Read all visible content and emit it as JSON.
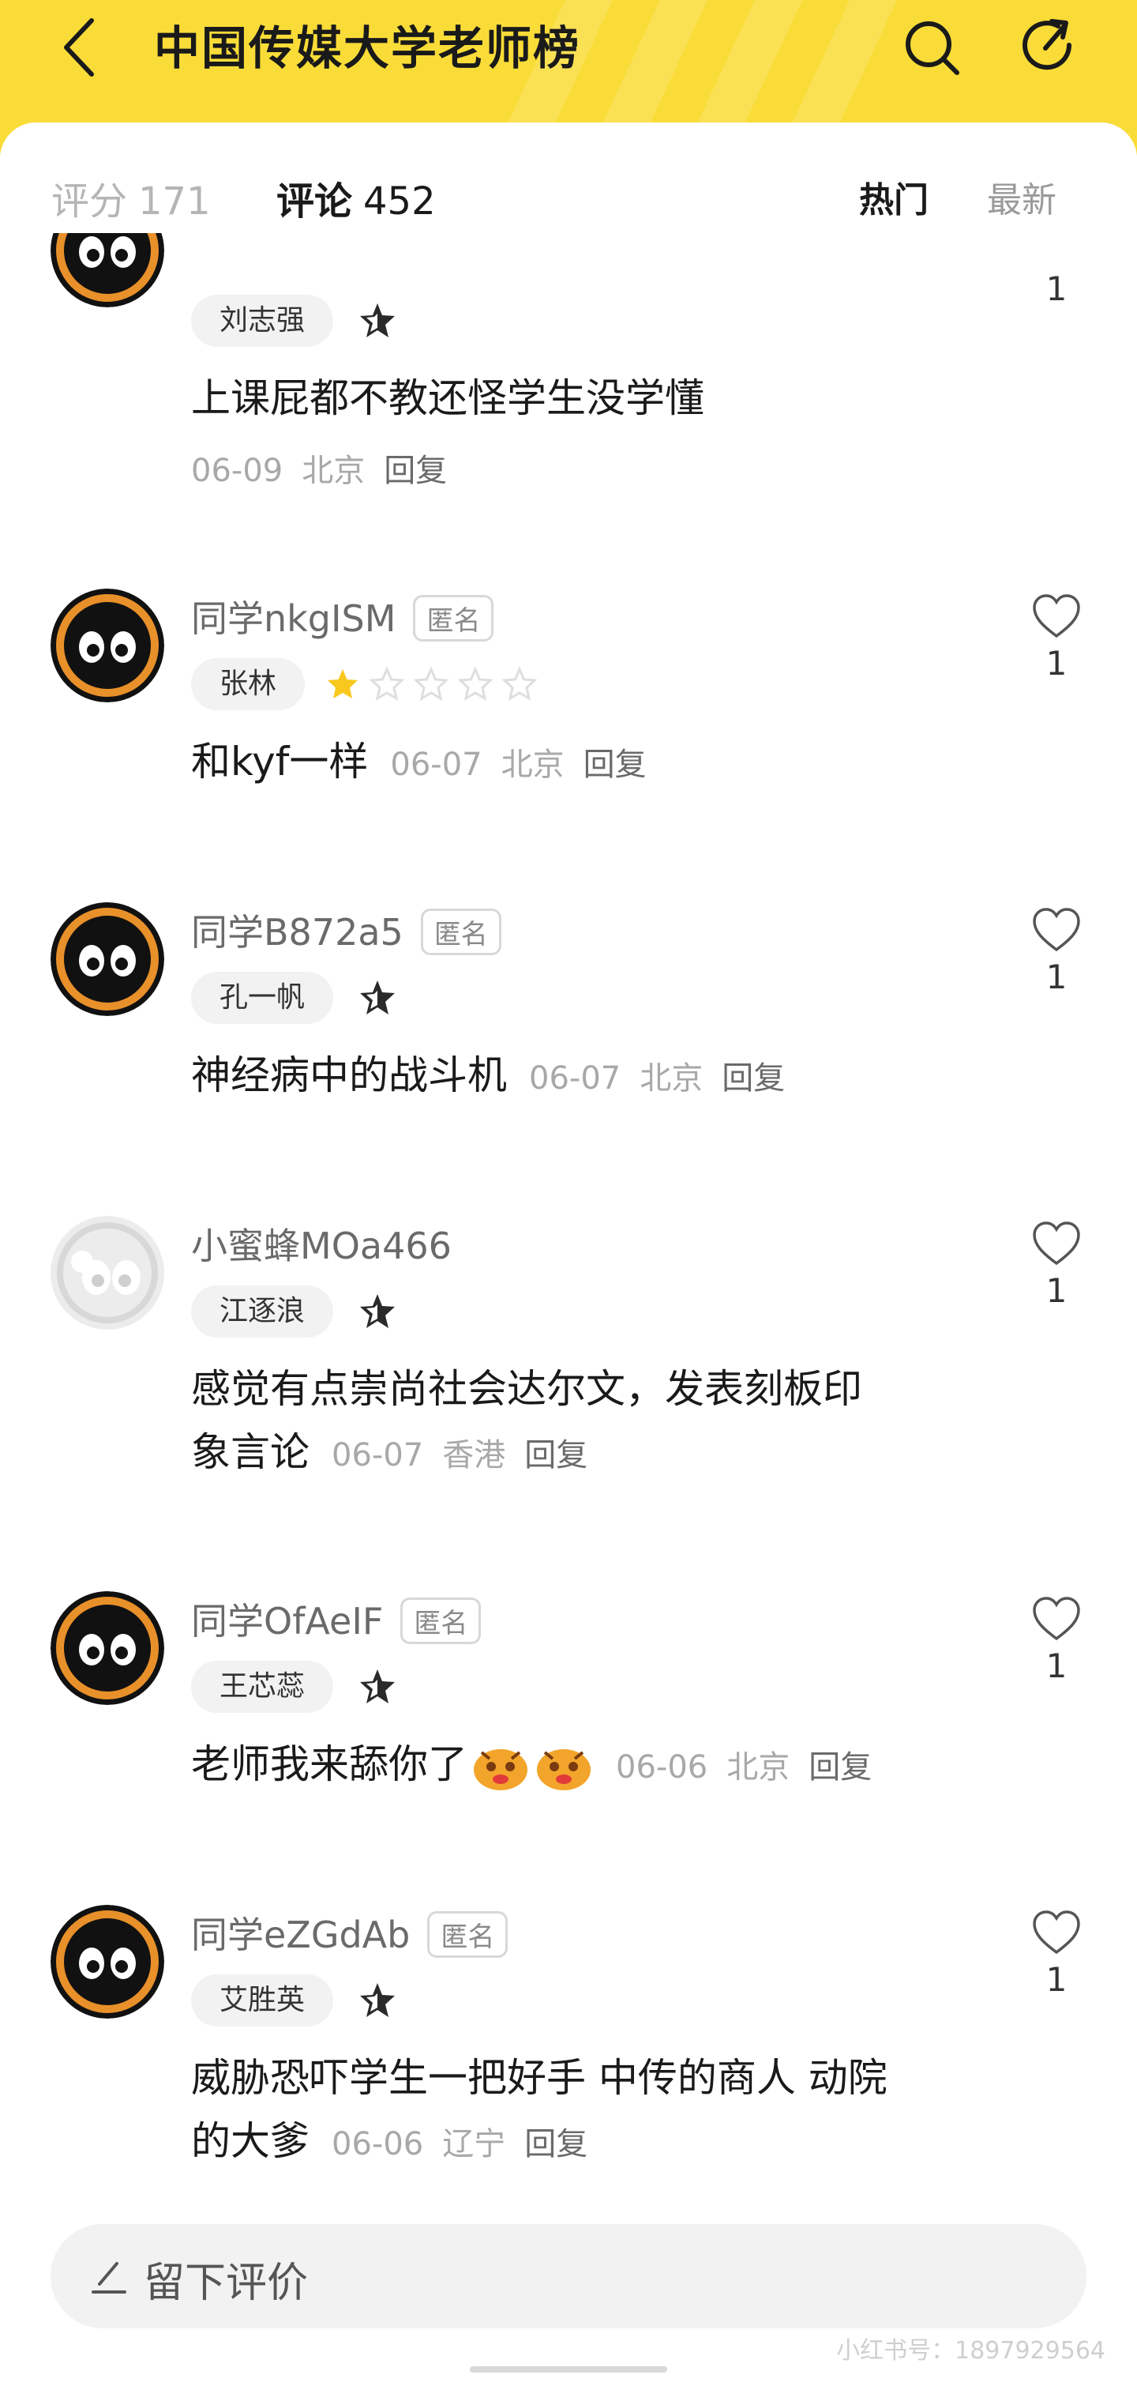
{
  "header": {
    "title": "中国传媒大学老师榜",
    "accent_color": "#f9dc38",
    "back_icon": "chevron-left-icon",
    "search_icon": "search-icon",
    "share_icon": "share-icon"
  },
  "tabs": {
    "score_label": "评分",
    "score_count": "171",
    "comment_label": "评论",
    "comment_count": "452",
    "sort_hot": "热门",
    "sort_new": "最新"
  },
  "comments": [
    {
      "teacher": "刘志强",
      "text": "上课屁都不教还怪学生没学懂",
      "date": "06-09",
      "location": "北京",
      "reply": "回复",
      "likes": "1"
    },
    {
      "username": "同学nkgISM",
      "anon_badge": "匿名",
      "teacher": "张林",
      "stars": 1,
      "text": "和kyf一样",
      "date": "06-07",
      "location": "北京",
      "reply": "回复",
      "likes": "1"
    },
    {
      "username": "同学B872a5",
      "anon_badge": "匿名",
      "teacher": "孔一帆",
      "text": "神经病中的战斗机",
      "date": "06-07",
      "location": "北京",
      "reply": "回复",
      "likes": "1"
    },
    {
      "username": "小蜜蜂MOa466",
      "teacher": "江逐浪",
      "text_line1": "感觉有点崇尚社会达尔文，发表刻板印",
      "text_line2": "象言论",
      "date": "06-07",
      "location": "香港",
      "reply": "回复",
      "likes": "1"
    },
    {
      "username": "同学OfAeIF",
      "anon_badge": "匿名",
      "teacher": "王芯蕊",
      "text": "老师我来舔你了",
      "date": "06-06",
      "location": "北京",
      "reply": "回复",
      "likes": "1"
    },
    {
      "username": "同学eZGdAb",
      "anon_badge": "匿名",
      "teacher": "艾胜英",
      "text_line1": "威胁恐吓学生一把好手 中传的商人 动院",
      "text_line2": "的大爹",
      "date": "06-06",
      "location": "辽宁",
      "reply": "回复",
      "likes": "1"
    }
  ],
  "input": {
    "placeholder": "留下评价"
  },
  "watermark": "小红书号：1897929564"
}
